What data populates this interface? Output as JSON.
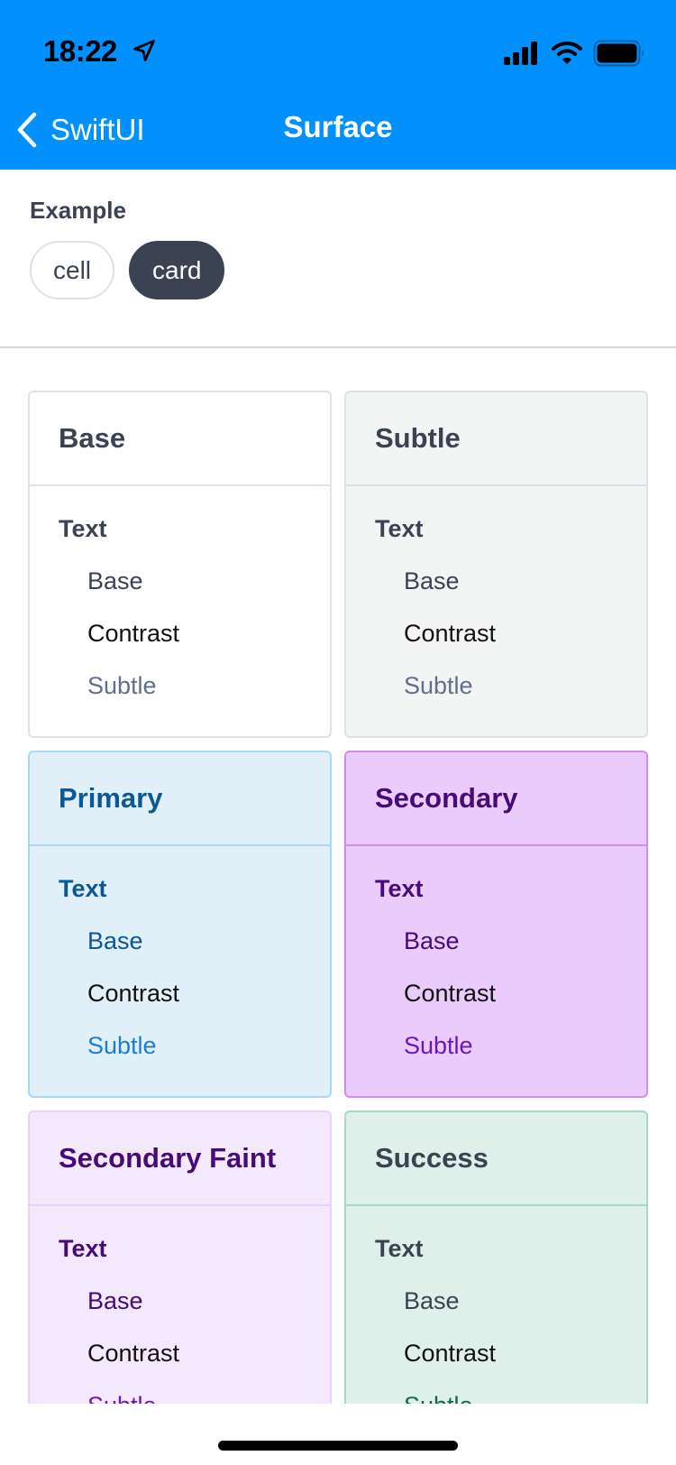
{
  "status_bar": {
    "time": "18:22",
    "icons": [
      "location-arrow-icon",
      "cellular-signal-icon",
      "wifi-icon",
      "battery-icon"
    ]
  },
  "nav": {
    "back_label": "SwiftUI",
    "title": "Surface",
    "background": "#0091ff"
  },
  "example": {
    "label": "Example",
    "options": [
      {
        "label": "cell",
        "selected": false
      },
      {
        "label": "card",
        "selected": true
      }
    ]
  },
  "cards": [
    {
      "title": "Base",
      "section": "Text",
      "items": [
        "Base",
        "Contrast",
        "Subtle"
      ],
      "colors": {
        "bg": "#ffffff",
        "border": "#dfe3ea",
        "title": "#3b4352",
        "base": "#3b4352",
        "contrast": "#111111",
        "subtle": "#5f6f8c"
      }
    },
    {
      "title": "Subtle",
      "section": "Text",
      "items": [
        "Base",
        "Contrast",
        "Subtle"
      ],
      "colors": {
        "bg": "#f3f4f4",
        "border": "#dfe1e8",
        "title": "#3b4352",
        "base": "#3b4352",
        "contrast": "#111111",
        "subtle": "#5f6f8c"
      }
    },
    {
      "title": "Primary",
      "section": "Text",
      "items": [
        "Base",
        "Contrast",
        "Subtle"
      ],
      "colors": {
        "bg": "#e0eff8",
        "border": "#a9d8f5",
        "title": "#0b5896",
        "base": "#0b5896",
        "contrast": "#111111",
        "subtle": "#1b7fcf"
      }
    },
    {
      "title": "Secondary",
      "section": "Text",
      "items": [
        "Base",
        "Contrast",
        "Subtle"
      ],
      "colors": {
        "bg": "#eacbfb",
        "border": "#d18cf2",
        "title": "#460b78",
        "base": "#460b78",
        "contrast": "#111111",
        "subtle": "#6a19b8"
      }
    },
    {
      "title": "Secondary Faint",
      "section": "Text",
      "items": [
        "Base",
        "Contrast",
        "Subtle"
      ],
      "colors": {
        "bg": "#f4e8fc",
        "border": "#ead0fa",
        "title": "#460b78",
        "base": "#460b78",
        "contrast": "#111111",
        "subtle": "#6a19b8"
      }
    },
    {
      "title": "Success",
      "section": "Text",
      "items": [
        "Base",
        "Contrast",
        "Subtle"
      ],
      "colors": {
        "bg": "#dff0ea",
        "border": "#a7d9c6",
        "title": "#3b4352",
        "base": "#3b4352",
        "contrast": "#111111",
        "subtle": "#0f6a45"
      }
    }
  ]
}
